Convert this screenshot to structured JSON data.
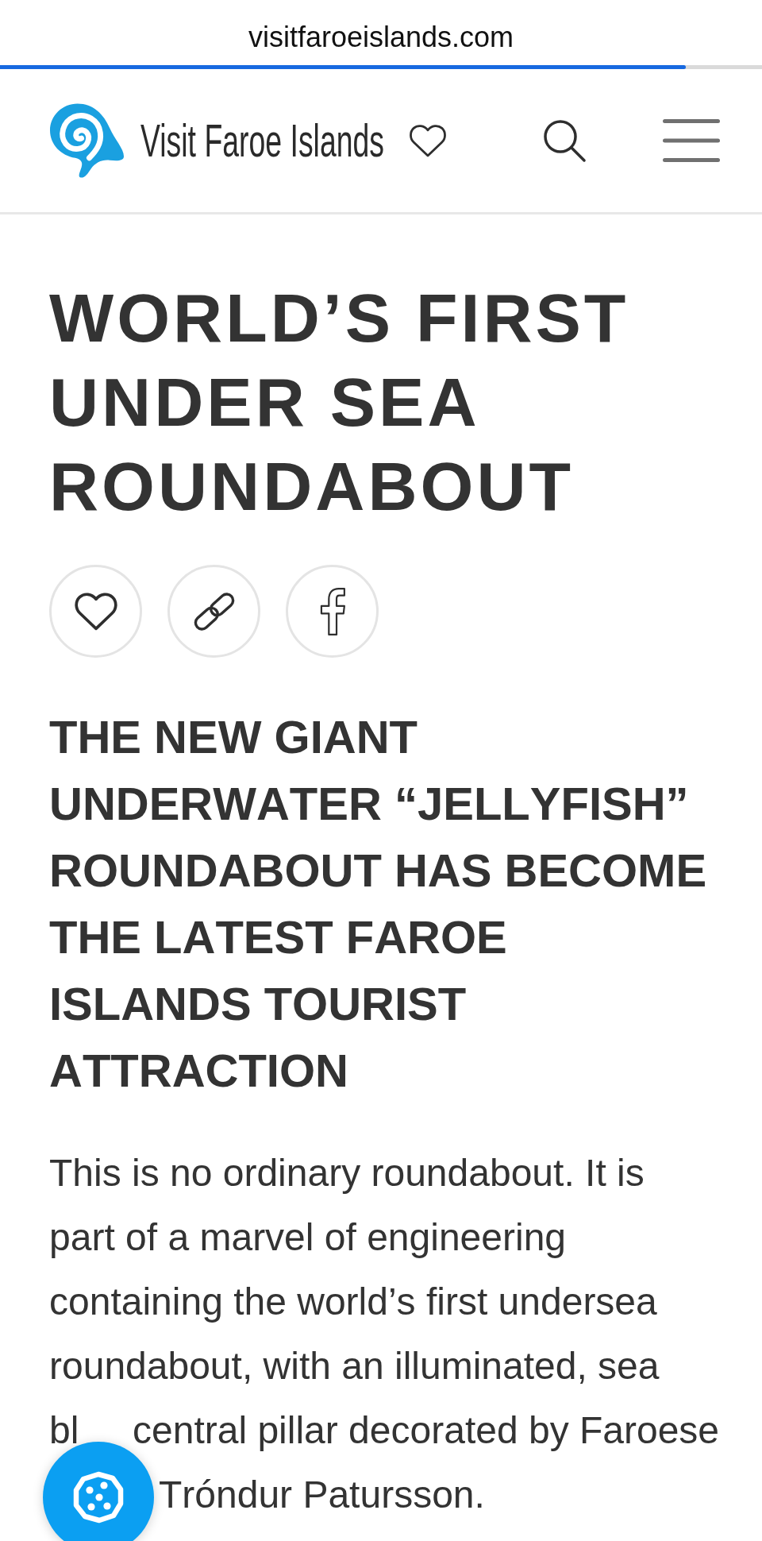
{
  "browser": {
    "url": "visitfaroeislands.com",
    "progress": {
      "level": 0.9
    }
  },
  "header": {
    "site_name": "Visit Faroe Islands"
  },
  "article": {
    "title": "WORLD’S FIRST UNDER SEA ROUNDABOUT",
    "share_buttons": [
      {
        "kind": "favorite"
      },
      {
        "kind": "link"
      },
      {
        "kind": "facebook"
      }
    ],
    "subtitle": "THE NEW GIANT UNDERWATER “JELLYFISH” ROUNDABOUT HAS BECOME THE LATEST FAROE ISLANDS TOURIST ATTRACTION",
    "body": {
      "text": "This is no ordinary roundabout. It is part of a marvel of engineering containing the world’s first undersea roundabout, with an illuminated, sea",
      "lines_beside_cookie_button": [
        {
          "before": "bl",
          "after": "central pillar decorated by Faroese"
        },
        {
          "after": "Tróndur Patursson."
        }
      ]
    }
  }
}
